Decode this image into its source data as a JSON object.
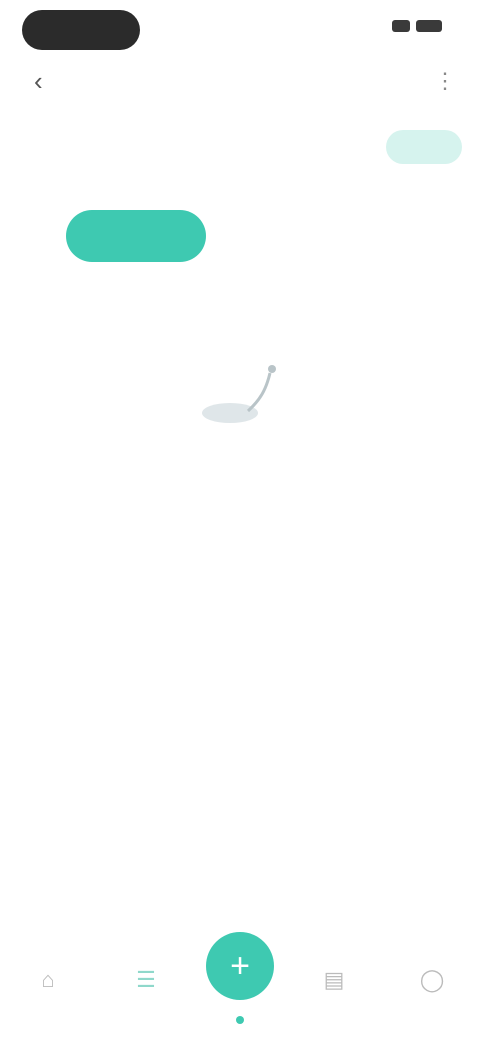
{
  "status_bar": {
    "time": "",
    "icons": [
      "signal-icon",
      "battery-icon"
    ]
  },
  "header": {
    "title": "",
    "back_icon": "back-arrow-icon",
    "more_icon": "more-icon"
  },
  "info_row": {
    "label": "",
    "sub": "",
    "pill": ""
  },
  "tabs": [
    {
      "label": "",
      "active": true
    },
    {
      "label": "",
      "active": false
    },
    {
      "label": "",
      "active": false
    }
  ],
  "empty_state": {
    "title": "",
    "description": ""
  },
  "bottom_nav": {
    "items": [
      {
        "icon": "home-icon"
      },
      {
        "icon": "list-icon"
      },
      {
        "icon": "plus-icon"
      },
      {
        "icon": "chart-icon"
      },
      {
        "icon": "profile-icon"
      }
    ]
  },
  "colors": {
    "accent": "#3ec9b1",
    "accent_light": "#d6f3ee"
  }
}
